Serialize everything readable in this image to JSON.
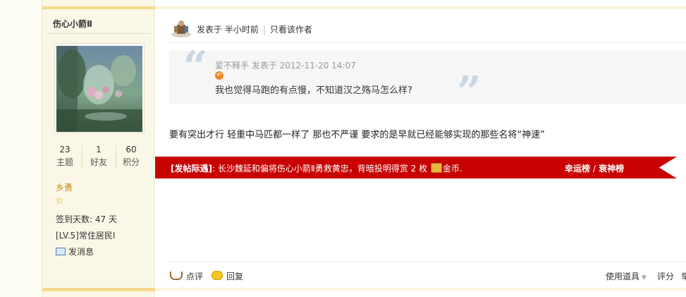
{
  "author": {
    "name": "伤心小箭Ⅱ",
    "stats": [
      {
        "value": "23",
        "label": "主题"
      },
      {
        "value": "1",
        "label": "好友"
      },
      {
        "value": "60",
        "label": "积分"
      }
    ],
    "rank": "乡勇",
    "sign_days": "签到天数: 47 天",
    "level": "[LV.5]常住居民I",
    "message_label": "发消息"
  },
  "post": {
    "posted_label": "发表于 半小时前",
    "only_author_label": "只看该作者",
    "quote": {
      "meta": "爱不释手 发表于 2012-11-20 14:07",
      "text": "我也觉得马跑的有点慢，不知道汉之殇马怎么样?"
    },
    "body": "要有突出才行   轻重中马匹都一样了  那也不严谨   要求的是早就已经能够实现的那些名将“神速”"
  },
  "ribbon": {
    "prefix": "[发帖际遇]",
    "text_before": ": 长沙魏延和偏将伤心小箭Ⅱ勇救黄忠，背暗投明得赏 2 枚 ",
    "text_after": "金币.",
    "link_lucky": "幸运榜",
    "link_sep": "/",
    "link_unlucky": "衰神榜",
    "color": "#c80000"
  },
  "footer": {
    "comment_label": "点评",
    "reply_label": "回复",
    "tools_label": "使用道具",
    "rate_label": "评分",
    "extra_label": "举"
  }
}
